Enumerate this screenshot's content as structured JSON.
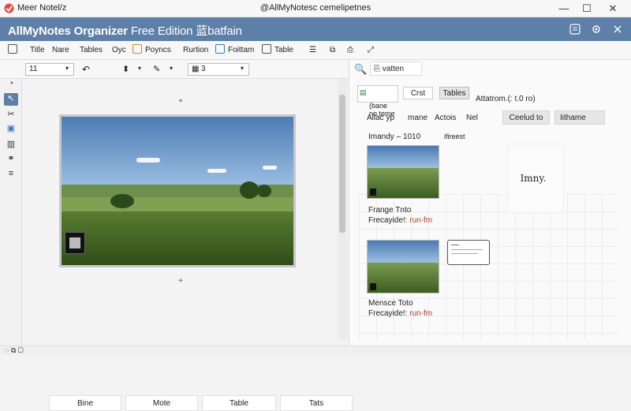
{
  "window": {
    "app_title": "Meer Notel/z",
    "center_title": "@AllMyNotesc cemelipetnes",
    "controls": {
      "minimize": "—",
      "maximize": "☐",
      "close": "✕"
    }
  },
  "appbar": {
    "brand_bold": "AllMyNotes Organizer",
    "brand_edition": "Free Edition 蓝batfain",
    "icons": [
      "note-icon",
      "gear-icon",
      "close-icon"
    ]
  },
  "toolbar1": {
    "items": [
      "Title",
      "Nare",
      "Tables",
      "Oyc",
      "Poyncs",
      "Rurtion",
      "Foittam",
      "Table"
    ]
  },
  "toolbar2": {
    "font_size": "11",
    "layout_value": "3"
  },
  "canvas": {
    "tabs": [
      "Bine",
      "Mote",
      "Table",
      "Tats"
    ]
  },
  "rightpanel": {
    "search_tab": "vatten",
    "filter_buttons": [
      "(bane\nno teme",
      "Crst",
      "Tables"
    ],
    "filter_label": "Attatrom.(: t.0 ro)",
    "column_headers": [
      "Ailac yp",
      "mane",
      "Actois",
      "Nel"
    ],
    "action_buttons": [
      "Ceelud to",
      "Iithame"
    ],
    "list_title": "Imandy – 1010",
    "list_subtitle": "ifireest",
    "items": [
      {
        "caption_line1": "Frange Tnto",
        "caption_prefix": "Frecayide!:",
        "caption_highlight": "run-fm"
      },
      {
        "caption_line1": "Mensce Toto",
        "caption_prefix": "Frecayide!:",
        "caption_highlight": "run-fm"
      }
    ],
    "side_note": "Imny."
  },
  "colors": {
    "appbar": "#5d7fa8",
    "highlight": "#b23b2a"
  }
}
